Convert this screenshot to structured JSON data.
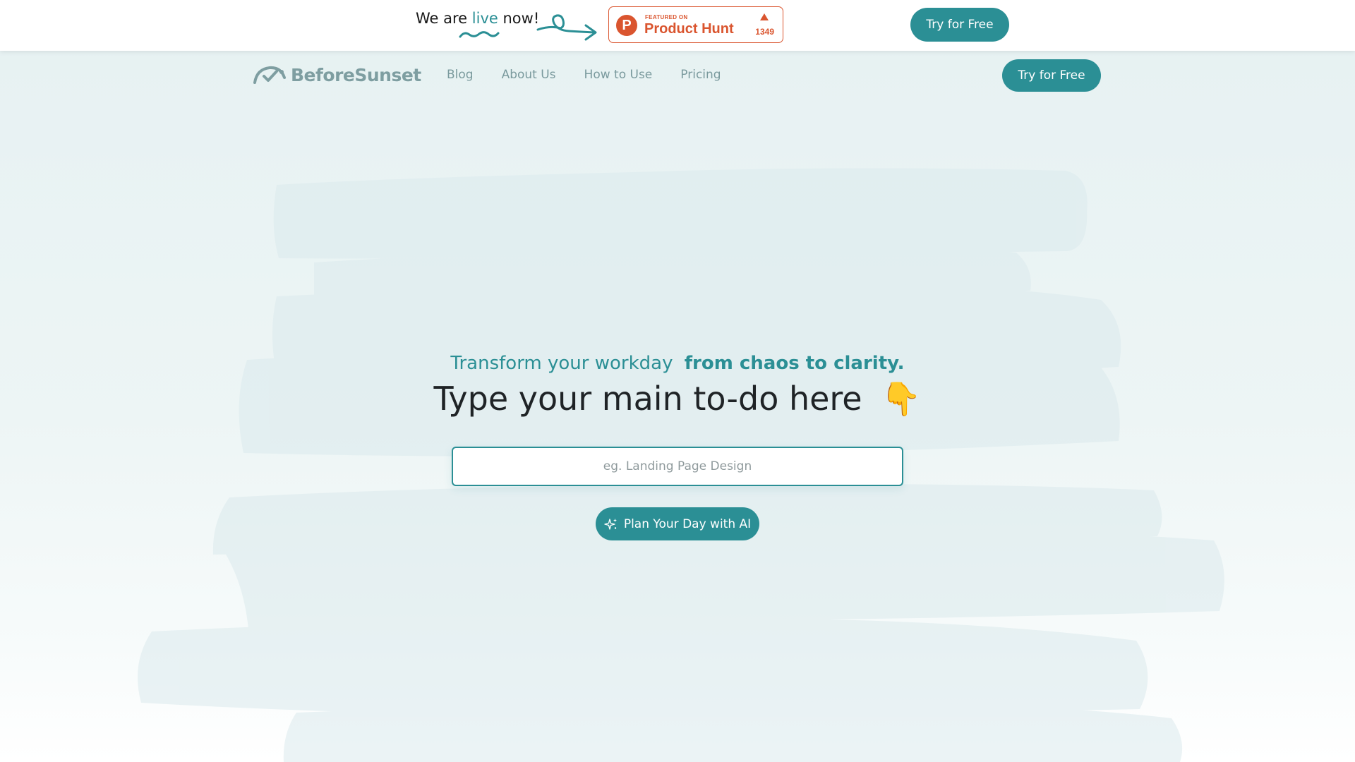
{
  "announcement": {
    "prefix": "We are",
    "highlight": "live",
    "suffix": "now!",
    "product_hunt": {
      "featured_label": "FEATURED ON",
      "name": "Product Hunt",
      "logo_letter": "P",
      "upvotes": "1349"
    },
    "cta_label": "Try for Free"
  },
  "navbar": {
    "brand": "BeforeSunset",
    "links": [
      "Blog",
      "About Us",
      "How to Use",
      "Pricing"
    ],
    "cta_label": "Try for Free"
  },
  "hero": {
    "tagline_plain": "Transform your workday",
    "tagline_bold": "from chaos to clarity.",
    "title": "Type your main to-do here",
    "title_emoji": "👇",
    "input_placeholder": "eg. Landing Page Design",
    "input_value": "",
    "cta_label": "Plan Your Day with AI"
  },
  "colors": {
    "brand_teal": "#2b8f95",
    "product_hunt": "#da552f",
    "title": "#1f2326",
    "nav_text": "#7a9a9d"
  },
  "icons": {
    "brand_logo": "checkmark-arc-icon",
    "plan_button": "sparkles-icon",
    "product_hunt": "product-hunt-logo",
    "upvote": "triangle-up-icon"
  }
}
